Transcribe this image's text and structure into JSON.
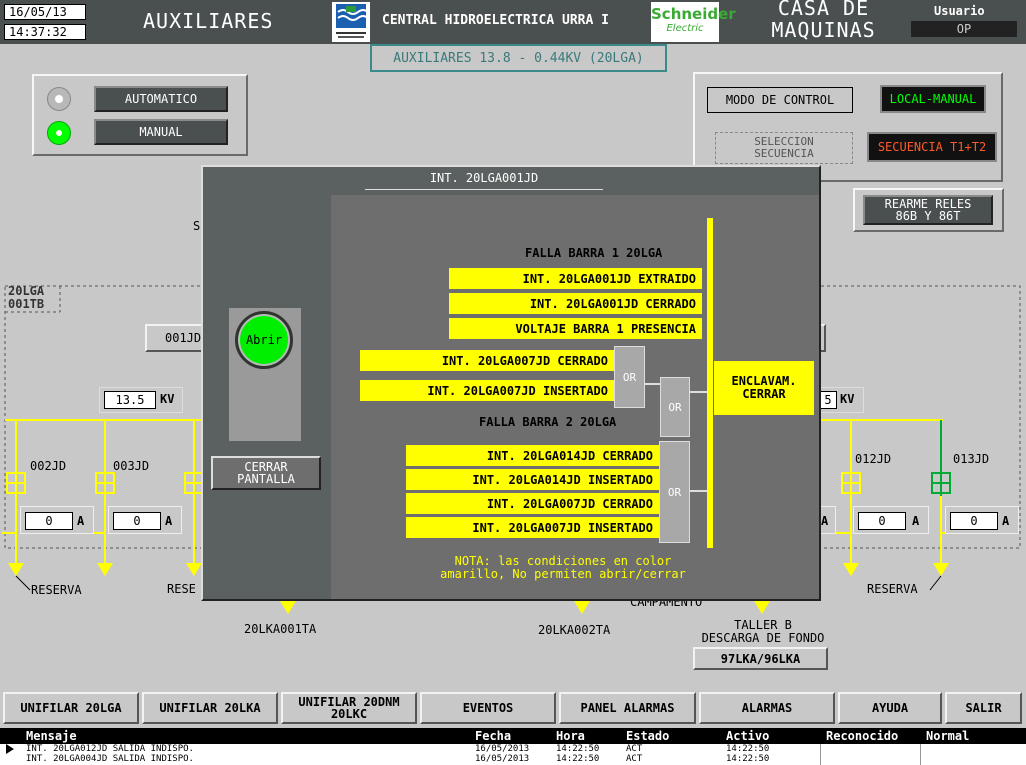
{
  "header": {
    "date": "16/05/13",
    "time": "14:37:32",
    "title_left": "AUXILIARES",
    "company": "CENTRAL HIDROELECTRICA URRA I",
    "logo_text": "Schneider",
    "logo_sub": "Electric",
    "title_right_1": "CASA DE",
    "title_right_2": "MAQUINAS",
    "user_label": "Usuario",
    "user_value": "OP",
    "subtitle": "AUXILIARES 13.8 - 0.44KV (20LGA)"
  },
  "mode_panel": {
    "automatic": "AUTOMATICO",
    "manual": "MANUAL"
  },
  "control_panel": {
    "modo": "MODO DE CONTROL",
    "local": "LOCAL-MANUAL",
    "seleccion": "SELECCION\nSECUENCIA",
    "secuencia": "SECUENCIA T1+T2",
    "rearme": "REARME RELES\n86B Y 86T"
  },
  "diagram": {
    "bus_label_1": "20LGA",
    "bus_label_2": "001TB",
    "breaker_main": "001JD",
    "kv_left": "13.5",
    "kv_unit": "KV",
    "kv_right": "5",
    "feeders": [
      {
        "name": "002JD",
        "value": "0",
        "unit": "A"
      },
      {
        "name": "003JD",
        "value": "0",
        "unit": "A"
      },
      {
        "name": "012JD",
        "value": "0",
        "unit": "A"
      },
      {
        "name": "013JD",
        "value": "0",
        "unit": "A"
      }
    ],
    "reserva_left": "RESERVA",
    "reserva_left2": "RESE",
    "reserva_right": "RESERVA",
    "camp": "CAMPAMENTO",
    "load_1": "20LKA001TA",
    "load_2": "20LKA002TA",
    "taller": "TALLER B",
    "descarga": "DESCARGA DE FONDO",
    "lka_button": "97LKA/96LKA",
    "s_label": "S"
  },
  "popup": {
    "title": "INT. 20LGA001JD",
    "abrir": "Abrir",
    "cerrar_pantalla": "CERRAR\nPANTALLA",
    "falla1": "FALLA BARRA 1 20LGA",
    "cond1": [
      "INT. 20LGA001JD EXTRAIDO",
      "INT. 20LGA001JD CERRADO",
      "VOLTAJE BARRA 1 PRESENCIA"
    ],
    "cond_or1": [
      "INT. 20LGA007JD CERRADO",
      "INT. 20LGA007JD INSERTADO"
    ],
    "falla2": "FALLA BARRA 2 20LGA",
    "cond_or3": [
      "INT. 20LGA014JD CERRADO",
      "INT. 20LGA014JD INSERTADO",
      "INT. 20LGA007JD CERRADO",
      "INT. 20LGA007JD INSERTADO"
    ],
    "or": "OR",
    "enclavam": "ENCLAVAM.\nCERRAR",
    "nota": "NOTA: las condiciones en color\namarillo, No permiten abrir/cerrar"
  },
  "toolbar": [
    "UNIFILAR 20LGA",
    "UNIFILAR 20LKA",
    "UNIFILAR 20DNM\n20LKC",
    "EVENTOS",
    "PANEL ALARMAS",
    "ALARMAS",
    "AYUDA",
    "SALIR"
  ],
  "alarm_table": {
    "columns": [
      "Mensaje",
      "Fecha",
      "Hora",
      "Estado",
      "Activo",
      "Reconocido",
      "Normal"
    ],
    "rows": [
      [
        "INT. 20LGA012JD SALIDA INDISPO.",
        "16/05/2013",
        "14:22:50",
        "ACT",
        "14:22:50",
        "",
        ""
      ],
      [
        "INT. 20LGA004JD SALIDA INDISPO.",
        "16/05/2013",
        "14:22:50",
        "ACT",
        "14:22:50",
        "",
        ""
      ]
    ]
  },
  "colors": {
    "yellow": "#ffff00",
    "green_on": "#00ff00",
    "popup_bg": "#6e6e6e",
    "header_bg": "#4a4f4f"
  }
}
